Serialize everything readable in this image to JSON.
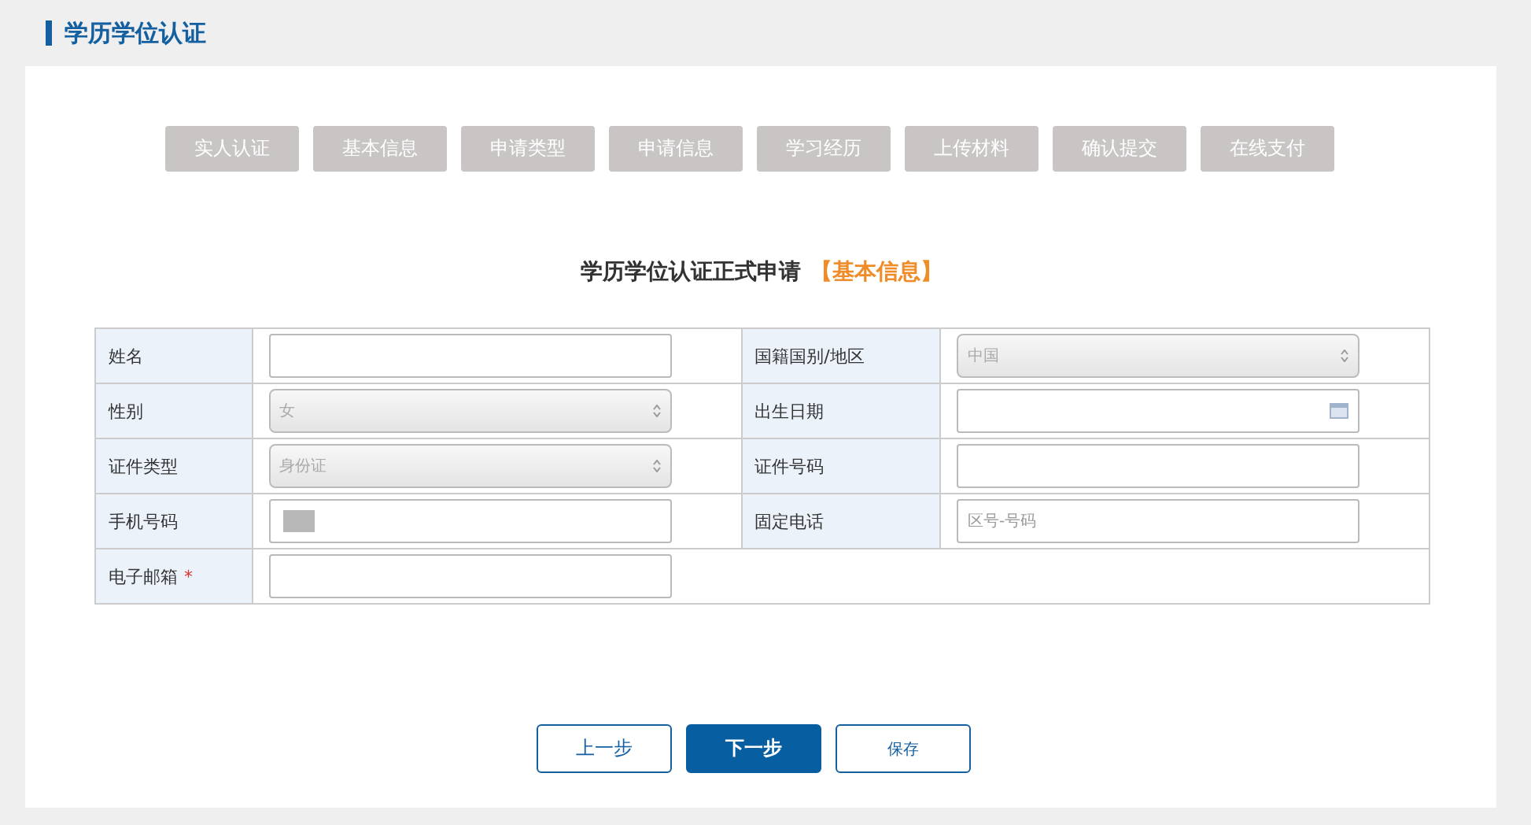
{
  "page_title": "学历学位认证",
  "steps": [
    {
      "label": "实人认证"
    },
    {
      "label": "基本信息"
    },
    {
      "label": "申请类型"
    },
    {
      "label": "申请信息"
    },
    {
      "label": "学习经历"
    },
    {
      "label": "上传材料"
    },
    {
      "label": "确认提交"
    },
    {
      "label": "在线支付"
    }
  ],
  "form_title": "学历学位认证正式申请",
  "form_section": "【基本信息】",
  "rows": [
    [
      {
        "label": "姓名",
        "kind": "text"
      },
      {
        "label": "国籍国别/地区",
        "kind": "select",
        "value": "中国"
      }
    ],
    [
      {
        "label": "性别",
        "kind": "select",
        "value": "女"
      },
      {
        "label": "出生日期",
        "kind": "date"
      }
    ],
    [
      {
        "label": "证件类型",
        "kind": "select",
        "value": "身份证"
      },
      {
        "label": "证件号码",
        "kind": "text"
      }
    ],
    [
      {
        "label": "手机号码",
        "kind": "text",
        "redacted": true
      },
      {
        "label": "固定电话",
        "kind": "text",
        "placeholder": "区号-号码"
      }
    ],
    [
      {
        "label": "电子邮箱",
        "kind": "text",
        "required_mark": "*"
      }
    ]
  ],
  "buttons": [
    {
      "label": "上一步",
      "kind": "outline"
    },
    {
      "label": "下一步",
      "kind": "primary"
    },
    {
      "label": "保存",
      "kind": "outline-small"
    }
  ]
}
